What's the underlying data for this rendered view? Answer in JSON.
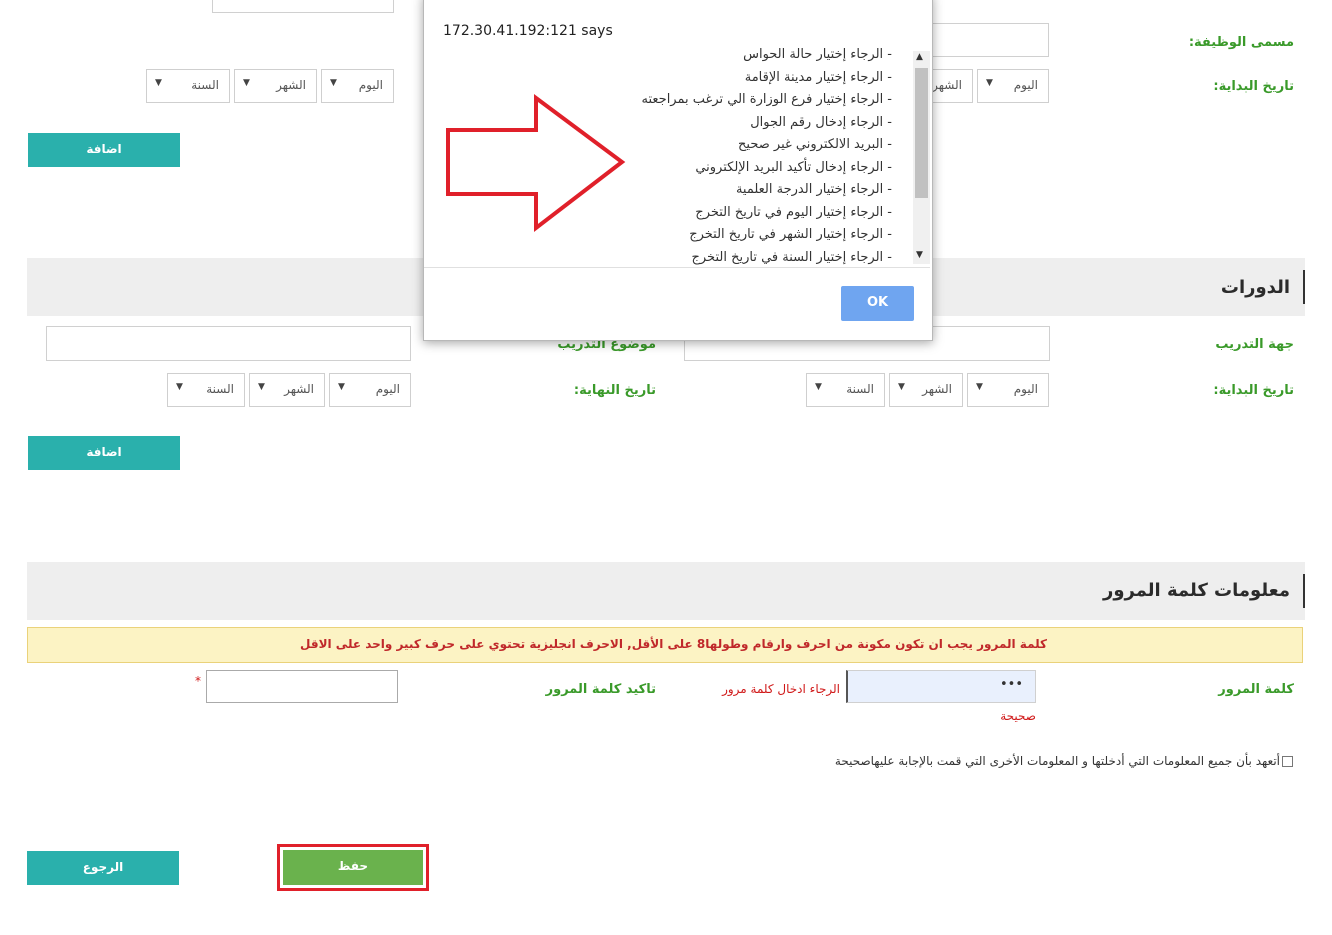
{
  "top_form": {
    "job_title_label": "مسمى الوظيفة:",
    "start_date_label": "تاريخ البداية:",
    "day": "اليوم",
    "month": "الشهر",
    "year": "السنة",
    "add_label": "اضافة"
  },
  "courses": {
    "title": "الدورات",
    "training_body_label": "جهة التدريب",
    "training_topic_label": "موضوع التدريب",
    "start_date_label": "تاريخ البداية:",
    "end_date_label": "تاريخ النهاية:",
    "day": "اليوم",
    "month": "الشهر",
    "year": "السنة",
    "add_label": "اضافة"
  },
  "password": {
    "title": "معلومات كلمة المرور",
    "warning": "كلمة المرور يجب ان تكون مكونة من احرف وارقام وطولها8 على الأقل, الاحرف انجليزية تحتوي على حرف كبير واحد على الاقل",
    "password_label": "كلمة المرور",
    "password_value": "•••",
    "password_error_1": "الرجاء ادخال كلمة مرور",
    "password_error_2": "صحيحة",
    "confirm_label": "تاكيد كلمة المرور",
    "required_mark": "*"
  },
  "pledge_text": "أتعهد بأن جميع المعلومات التي أدخلتها و المعلومات الأخرى التي قمت بالإجابة عليهاصحيحة",
  "buttons": {
    "save": "حفظ",
    "back": "الرجوع"
  },
  "dialog": {
    "title": "172.30.41.192:121 says",
    "messages": [
      "- الرجاء إختيار حالة الحواس",
      "- الرجاء إختيار مدينة الإقامة",
      "- الرجاء إختيار فرع الوزارة الي ترغب بمراجعته",
      "- الرجاء إدخال رقم الجوال",
      "- البريد الالكتروني غير صحيح",
      "- الرجاء إدخال تأكيد البريد الإلكتروني",
      "- الرجاء إختيار الدرجة العلمية",
      "- الرجاء إختيار اليوم  في تاريخ التخرج",
      "- الرجاء إختيار الشهر في تاريخ التخرج",
      "- الرجاء إختيار السنة في تاريخ التخرج"
    ],
    "ok_label": "OK"
  },
  "colors": {
    "label_green": "#3a9a2a",
    "teal_button": "#2ab0ac",
    "save_button": "#6ab24d",
    "highlight_red": "#e0202a",
    "warning_bg": "#fcf3c4",
    "ok_button": "#6fa5f0"
  }
}
